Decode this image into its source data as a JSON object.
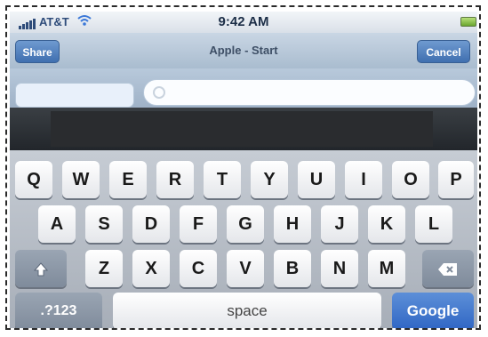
{
  "status": {
    "carrier": "AT&T",
    "time": "9:42 AM"
  },
  "nav": {
    "share_label": "Share",
    "title": "Apple - Start",
    "cancel_label": "Cancel"
  },
  "address": {
    "value": "",
    "placeholder": ""
  },
  "search": {
    "value": "",
    "placeholder": ""
  },
  "keyboard": {
    "row1": [
      "Q",
      "W",
      "E",
      "R",
      "T",
      "Y",
      "U",
      "I",
      "O",
      "P"
    ],
    "row2": [
      "A",
      "S",
      "D",
      "F",
      "G",
      "H",
      "J",
      "K",
      "L"
    ],
    "row3": [
      "Z",
      "X",
      "C",
      "V",
      "B",
      "N",
      "M"
    ],
    "mode_label": ".?123",
    "space_label": "space",
    "go_label": "Google"
  },
  "colors": {
    "accent": "#2f66c4",
    "nav": "#a9bccf"
  },
  "icons": {
    "wifi": "wifi-icon",
    "battery": "battery-icon",
    "shift": "shift-icon",
    "delete": "delete-icon",
    "search": "search-icon"
  }
}
